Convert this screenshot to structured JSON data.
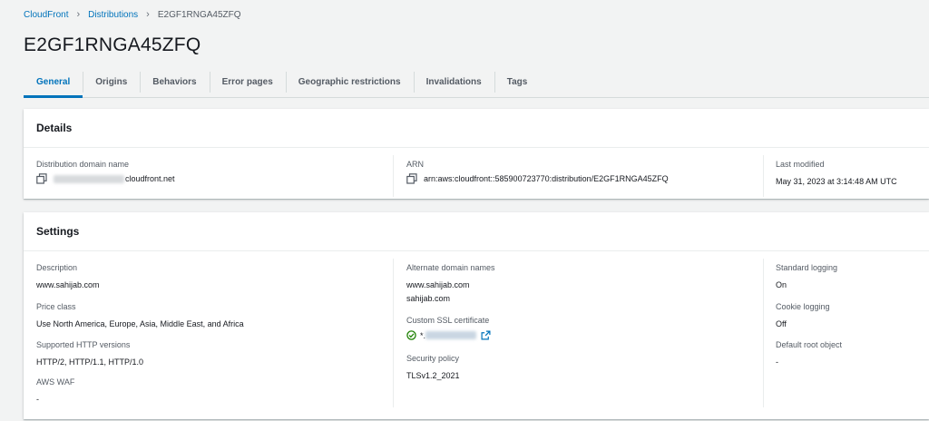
{
  "breadcrumb": {
    "items": [
      "CloudFront",
      "Distributions"
    ],
    "current": "E2GF1RNGA45ZFQ"
  },
  "page": {
    "title": "E2GF1RNGA45ZFQ"
  },
  "tabs": [
    {
      "label": "General",
      "active": true
    },
    {
      "label": "Origins"
    },
    {
      "label": "Behaviors"
    },
    {
      "label": "Error pages"
    },
    {
      "label": "Geographic restrictions"
    },
    {
      "label": "Invalidations"
    },
    {
      "label": "Tags"
    }
  ],
  "details": {
    "title": "Details",
    "distribution_domain": {
      "label": "Distribution domain name",
      "value": "cloudfront.net"
    },
    "arn": {
      "label": "ARN",
      "value": "arn:aws:cloudfront::585900723770:distribution/E2GF1RNGA45ZFQ"
    },
    "last_modified": {
      "label": "Last modified",
      "value": "May 31, 2023 at 3:14:48 AM UTC"
    }
  },
  "settings": {
    "title": "Settings",
    "description": {
      "label": "Description",
      "value": "www.sahijab.com"
    },
    "price_class": {
      "label": "Price class",
      "value": "Use North America, Europe, Asia, Middle East, and Africa"
    },
    "http_versions": {
      "label": "Supported HTTP versions",
      "value": "HTTP/2, HTTP/1.1, HTTP/1.0"
    },
    "aws_waf": {
      "label": "AWS WAF",
      "value": "-"
    },
    "alternate_domains": {
      "label": "Alternate domain names",
      "values": [
        "www.sahijab.com",
        "sahijab.com"
      ]
    },
    "ssl_certificate": {
      "label": "Custom SSL certificate",
      "prefix": "*."
    },
    "security_policy": {
      "label": "Security policy",
      "value": "TLSv1.2_2021"
    },
    "standard_logging": {
      "label": "Standard logging",
      "value": "On"
    },
    "cookie_logging": {
      "label": "Cookie logging",
      "value": "Off"
    },
    "default_root_object": {
      "label": "Default root object",
      "value": "-"
    }
  },
  "colors": {
    "link": "#0073bb",
    "success": "#1d8102",
    "background": "#f2f3f3"
  }
}
